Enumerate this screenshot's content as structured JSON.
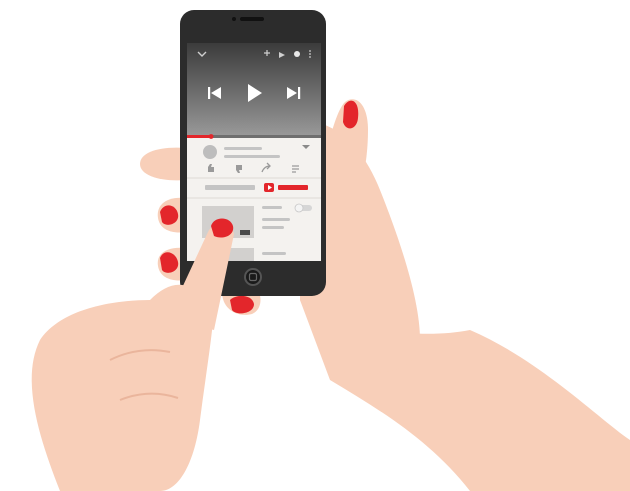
{
  "palette": {
    "skin": "#f8cfb9",
    "skin_shadow": "#eab59c",
    "nail": "#e3262b",
    "phone_body": "#2c2c2c",
    "screen_bg": "#f4f2ef",
    "video_top": "#3b3b3b",
    "video_bottom": "#8f8f8f",
    "placeholder_gray": "#bdbdbd",
    "accent_red": "#e3262b"
  },
  "player": {
    "progress_fraction": 0.18,
    "icons": [
      "chevron-down-icon",
      "add-to-queue-icon",
      "share-icon",
      "cast-icon",
      "more-icon",
      "previous-icon",
      "play-icon",
      "next-icon"
    ]
  },
  "actions": {
    "icons": [
      "like-icon",
      "dislike-icon",
      "share-icon",
      "save-icon"
    ]
  },
  "subscribe": {
    "icons": [
      "youtube-play-icon"
    ]
  },
  "up_next": {
    "autoplay_toggle_on": false
  }
}
